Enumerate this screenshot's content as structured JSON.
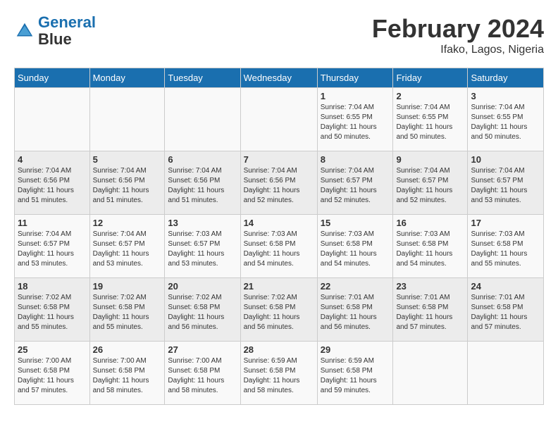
{
  "header": {
    "logo_line1": "General",
    "logo_line2": "Blue",
    "month_title": "February 2024",
    "location": "Ifako, Lagos, Nigeria"
  },
  "weekdays": [
    "Sunday",
    "Monday",
    "Tuesday",
    "Wednesday",
    "Thursday",
    "Friday",
    "Saturday"
  ],
  "weeks": [
    [
      {
        "day": "",
        "info": ""
      },
      {
        "day": "",
        "info": ""
      },
      {
        "day": "",
        "info": ""
      },
      {
        "day": "",
        "info": ""
      },
      {
        "day": "1",
        "info": "Sunrise: 7:04 AM\nSunset: 6:55 PM\nDaylight: 11 hours\nand 50 minutes."
      },
      {
        "day": "2",
        "info": "Sunrise: 7:04 AM\nSunset: 6:55 PM\nDaylight: 11 hours\nand 50 minutes."
      },
      {
        "day": "3",
        "info": "Sunrise: 7:04 AM\nSunset: 6:55 PM\nDaylight: 11 hours\nand 50 minutes."
      }
    ],
    [
      {
        "day": "4",
        "info": "Sunrise: 7:04 AM\nSunset: 6:56 PM\nDaylight: 11 hours\nand 51 minutes."
      },
      {
        "day": "5",
        "info": "Sunrise: 7:04 AM\nSunset: 6:56 PM\nDaylight: 11 hours\nand 51 minutes."
      },
      {
        "day": "6",
        "info": "Sunrise: 7:04 AM\nSunset: 6:56 PM\nDaylight: 11 hours\nand 51 minutes."
      },
      {
        "day": "7",
        "info": "Sunrise: 7:04 AM\nSunset: 6:56 PM\nDaylight: 11 hours\nand 52 minutes."
      },
      {
        "day": "8",
        "info": "Sunrise: 7:04 AM\nSunset: 6:57 PM\nDaylight: 11 hours\nand 52 minutes."
      },
      {
        "day": "9",
        "info": "Sunrise: 7:04 AM\nSunset: 6:57 PM\nDaylight: 11 hours\nand 52 minutes."
      },
      {
        "day": "10",
        "info": "Sunrise: 7:04 AM\nSunset: 6:57 PM\nDaylight: 11 hours\nand 53 minutes."
      }
    ],
    [
      {
        "day": "11",
        "info": "Sunrise: 7:04 AM\nSunset: 6:57 PM\nDaylight: 11 hours\nand 53 minutes."
      },
      {
        "day": "12",
        "info": "Sunrise: 7:04 AM\nSunset: 6:57 PM\nDaylight: 11 hours\nand 53 minutes."
      },
      {
        "day": "13",
        "info": "Sunrise: 7:03 AM\nSunset: 6:57 PM\nDaylight: 11 hours\nand 53 minutes."
      },
      {
        "day": "14",
        "info": "Sunrise: 7:03 AM\nSunset: 6:58 PM\nDaylight: 11 hours\nand 54 minutes."
      },
      {
        "day": "15",
        "info": "Sunrise: 7:03 AM\nSunset: 6:58 PM\nDaylight: 11 hours\nand 54 minutes."
      },
      {
        "day": "16",
        "info": "Sunrise: 7:03 AM\nSunset: 6:58 PM\nDaylight: 11 hours\nand 54 minutes."
      },
      {
        "day": "17",
        "info": "Sunrise: 7:03 AM\nSunset: 6:58 PM\nDaylight: 11 hours\nand 55 minutes."
      }
    ],
    [
      {
        "day": "18",
        "info": "Sunrise: 7:02 AM\nSunset: 6:58 PM\nDaylight: 11 hours\nand 55 minutes."
      },
      {
        "day": "19",
        "info": "Sunrise: 7:02 AM\nSunset: 6:58 PM\nDaylight: 11 hours\nand 55 minutes."
      },
      {
        "day": "20",
        "info": "Sunrise: 7:02 AM\nSunset: 6:58 PM\nDaylight: 11 hours\nand 56 minutes."
      },
      {
        "day": "21",
        "info": "Sunrise: 7:02 AM\nSunset: 6:58 PM\nDaylight: 11 hours\nand 56 minutes."
      },
      {
        "day": "22",
        "info": "Sunrise: 7:01 AM\nSunset: 6:58 PM\nDaylight: 11 hours\nand 56 minutes."
      },
      {
        "day": "23",
        "info": "Sunrise: 7:01 AM\nSunset: 6:58 PM\nDaylight: 11 hours\nand 57 minutes."
      },
      {
        "day": "24",
        "info": "Sunrise: 7:01 AM\nSunset: 6:58 PM\nDaylight: 11 hours\nand 57 minutes."
      }
    ],
    [
      {
        "day": "25",
        "info": "Sunrise: 7:00 AM\nSunset: 6:58 PM\nDaylight: 11 hours\nand 57 minutes."
      },
      {
        "day": "26",
        "info": "Sunrise: 7:00 AM\nSunset: 6:58 PM\nDaylight: 11 hours\nand 58 minutes."
      },
      {
        "day": "27",
        "info": "Sunrise: 7:00 AM\nSunset: 6:58 PM\nDaylight: 11 hours\nand 58 minutes."
      },
      {
        "day": "28",
        "info": "Sunrise: 6:59 AM\nSunset: 6:58 PM\nDaylight: 11 hours\nand 58 minutes."
      },
      {
        "day": "29",
        "info": "Sunrise: 6:59 AM\nSunset: 6:58 PM\nDaylight: 11 hours\nand 59 minutes."
      },
      {
        "day": "",
        "info": ""
      },
      {
        "day": "",
        "info": ""
      }
    ]
  ]
}
